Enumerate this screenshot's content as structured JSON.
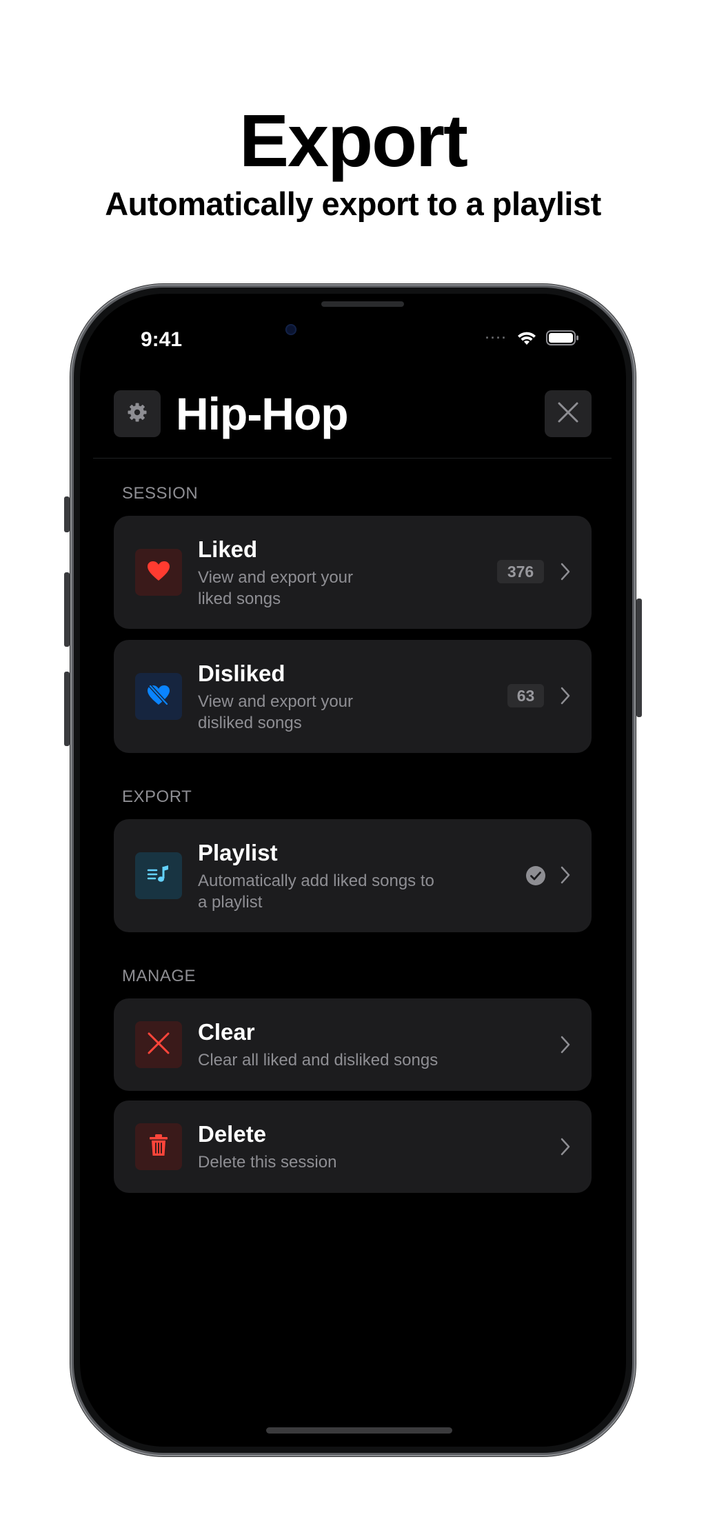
{
  "promo": {
    "title": "Export",
    "subtitle": "Automatically export to a playlist"
  },
  "status_bar": {
    "time": "9:41",
    "signal": "····"
  },
  "header": {
    "title": "Hip-Hop",
    "settings_icon": "gear-icon",
    "close_icon": "close-icon"
  },
  "sections": {
    "session": {
      "label": "SESSION",
      "items": [
        {
          "title": "Liked",
          "line1": "View and export your",
          "line2": "liked songs",
          "count": "376",
          "icon": "heart-icon",
          "icon_color": "#ff3b30"
        },
        {
          "title": "Disliked",
          "line1": "View and export your",
          "line2": "disliked songs",
          "count": "63",
          "icon": "heart-slash-icon",
          "icon_color": "#0a84ff"
        }
      ]
    },
    "export": {
      "label": "EXPORT",
      "items": [
        {
          "title": "Playlist",
          "line1": "Automatically add liked songs to",
          "line2": "a playlist",
          "status": "enabled",
          "icon": "music-list-icon",
          "icon_color": "#64d2ff"
        }
      ]
    },
    "manage": {
      "label": "MANAGE",
      "items": [
        {
          "title": "Clear",
          "subtitle": "Clear all liked and disliked songs",
          "icon": "x-mark-icon",
          "icon_color": "#ff453a"
        },
        {
          "title": "Delete",
          "subtitle": "Delete this session",
          "icon": "trash-icon",
          "icon_color": "#ff453a"
        }
      ]
    }
  },
  "colors": {
    "background": "#000000",
    "card": "#1c1c1e",
    "secondary_text": "#8e8e93",
    "accent_red": "#ff3b30",
    "accent_blue": "#0a84ff"
  }
}
